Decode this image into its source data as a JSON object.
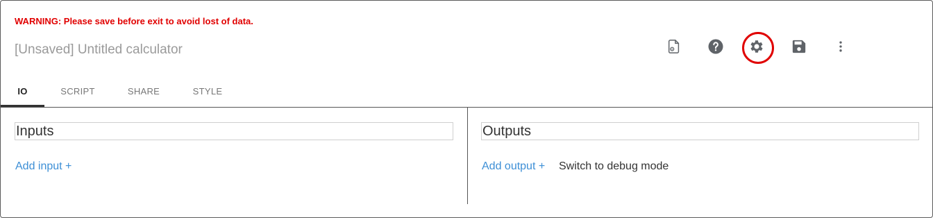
{
  "warning": "WARNING: Please save before exit to avoid lost of data.",
  "title": "[Unsaved] Untitled calculator",
  "toolbar": {
    "icons": [
      "file-settings-icon",
      "help-icon",
      "settings-icon",
      "save-icon",
      "more-vert-icon"
    ],
    "highlighted": "settings-icon",
    "highlight_color": "#e00000"
  },
  "tabs": [
    {
      "label": "IO",
      "active": true
    },
    {
      "label": "SCRIPT",
      "active": false
    },
    {
      "label": "SHARE",
      "active": false
    },
    {
      "label": "STYLE",
      "active": false
    }
  ],
  "inputs": {
    "heading": "Inputs",
    "add_label": "Add input +"
  },
  "outputs": {
    "heading": "Outputs",
    "add_label": "Add output +",
    "debug_label": "Switch to debug mode"
  },
  "colors": {
    "warning": "#e10000",
    "link": "#3d8fd6",
    "icon": "#5f6368"
  }
}
